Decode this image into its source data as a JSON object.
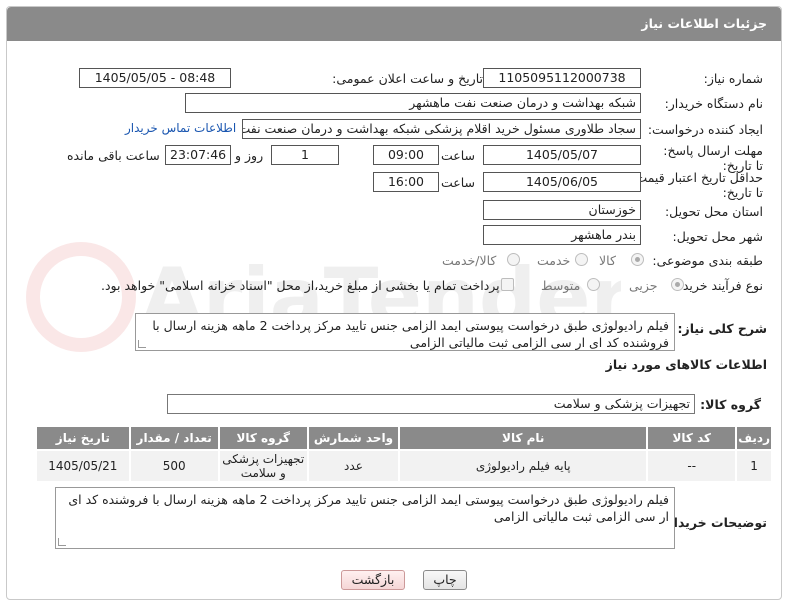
{
  "header": {
    "title": "جزئیات اطلاعات نیاز"
  },
  "form": {
    "need_number_label": "شماره نیاز:",
    "need_number": "1105095112000738",
    "announce_label": "تاریخ و ساعت اعلان عمومی:",
    "announce_value": "1405/05/05 - 08:48",
    "buyer_org_label": "نام دستگاه خریدار:",
    "buyer_org": "شبکه بهداشت و درمان صنعت نفت ماهشهر",
    "creator_label": "ایجاد کننده درخواست:",
    "creator": "سجاد طلاوری مسئول خرید اقلام پزشکی شبکه بهداشت و درمان صنعت نفت ماهشهر",
    "contact_link": "اطلاعات تماس خریدار",
    "reply_deadline_label": "مهلت ارسال پاسخ: تا تاریخ:",
    "reply_date": "1405/05/07",
    "time_label": "ساعت",
    "reply_time": "09:00",
    "days_value": "1",
    "days_label": "روز و",
    "remaining_time": "23:07:46",
    "remaining_label": "ساعت باقی مانده",
    "price_validity_label": "حداقل تاریخ اعتبار قیمت: تا تاریخ:",
    "price_date": "1405/06/05",
    "price_time": "16:00",
    "province_label": "استان محل تحویل:",
    "province": "خوزستان",
    "city_label": "شهر محل تحویل:",
    "city": "بندر ماهشهر",
    "category_label": "طبقه بندی موضوعی:",
    "category_options": [
      "کالا",
      "خدمت",
      "کالا/خدمت"
    ],
    "process_label": "نوع فرآیند خرید :",
    "process_options": [
      "جزیی",
      "متوسط"
    ],
    "payment_note": "پرداخت تمام یا بخشی از مبلغ خرید،از محل \"اسناد خزانه اسلامی\" خواهد بود."
  },
  "description": {
    "label": "شرح کلی نیاز:",
    "text": "فیلم رادیولوژی طبق درخواست پیوستی ایمد الزامی جنس تایید مرکز پرداخت 2 ماهه هزینه ارسال با فروشنده کد ای ار سی الزامی ثبت مالیاتی الزامی"
  },
  "goods": {
    "section_title": "اطلاعات کالاهای مورد نیاز",
    "group_label": "گروه کالا:",
    "group_value": "تجهیزات پزشکی و سلامت",
    "columns": [
      "ردیف",
      "کد کالا",
      "نام کالا",
      "واحد شمارش",
      "گروه کالا",
      "تعداد / مقدار",
      "تاریخ نیاز"
    ],
    "rows": [
      {
        "row": "1",
        "code": "--",
        "name": "پایه فیلم رادیولوژی",
        "unit": "عدد",
        "group": "تجهیزات پزشکی و سلامت",
        "qty": "500",
        "date": "1405/05/21"
      }
    ]
  },
  "buyer_notes": {
    "label": "توضیحات خریدار:",
    "text": "فیلم رادیولوژی طبق درخواست پیوستی ایمد الزامی جنس تایید مرکز پرداخت 2 ماهه هزینه ارسال با فروشنده کد ای ار سی الزامی ثبت مالیاتی الزامی"
  },
  "buttons": {
    "print": "چاپ",
    "back": "بازگشت"
  },
  "colors": {
    "header_bg": "#8a8a8a",
    "link": "#1a56b0"
  }
}
